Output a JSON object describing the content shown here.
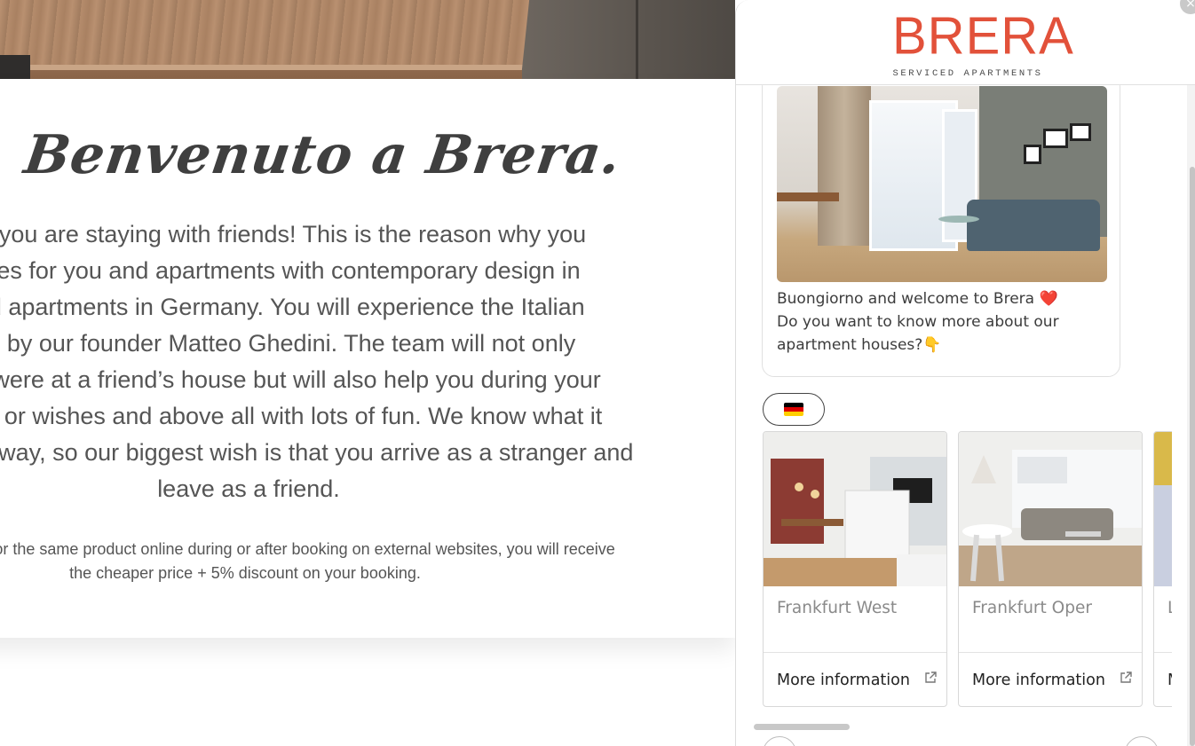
{
  "page": {
    "welcome_heading": "Benvenuto a Brera.",
    "intro_lines": [
      "feel like you are staying with friends! This is the reason why you",
      "that cares for you and apartments with contemporary design in",
      "serviced apartments in Germany. You will experience the Italian",
      "shaped by our founder Matteo Ghedini. The team will not only",
      "as if you were at a friend’s house but will also help you during your",
      "questions or wishes and above all with lots of fun. We know what it",
      "from home away, so our biggest wish is that you arrive as a stranger and",
      "leave as a friend."
    ],
    "price_note_lines": [
      "a cheaper price for the same product online during or after booking on external websites, you will receive",
      "the cheaper price + 5% discount on your booking."
    ]
  },
  "chat": {
    "brand": {
      "name": "BRERA",
      "tagline": "SERVICED APARTMENTS",
      "color": "#e2513a"
    },
    "close_icon": "×",
    "message": {
      "lines": [
        "Buongiorno and welcome to Brera ❤️",
        "Do you want to know more about our",
        "apartment houses?👇"
      ]
    },
    "language_chip": {
      "icon": "german-flag",
      "colors": [
        "#000000",
        "#dd0000",
        "#ffce00"
      ]
    },
    "cards": [
      {
        "title": "Frankfurt West",
        "action_label": "More information",
        "action_icon": "external-link-icon"
      },
      {
        "title": "Frankfurt Oper",
        "action_label": "More information",
        "action_icon": "external-link-icon"
      },
      {
        "title": "L",
        "action_label": "M",
        "action_icon": "external-link-icon"
      }
    ],
    "nav": {
      "prev_icon": "‹",
      "next_icon": "›"
    }
  }
}
